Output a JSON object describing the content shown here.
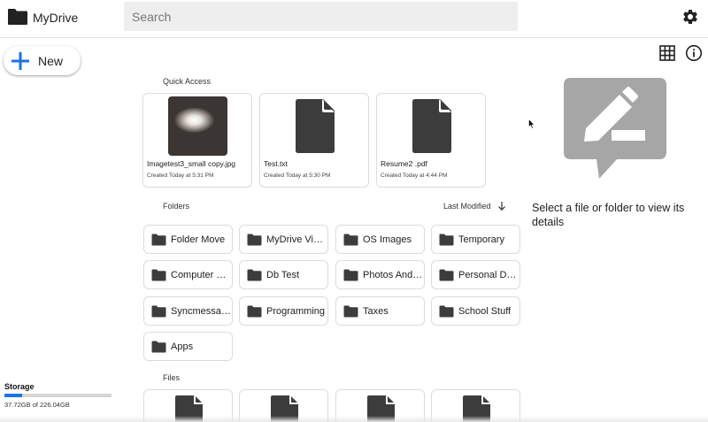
{
  "header": {
    "app_title": "MyDrive",
    "search_placeholder": "Search",
    "settings_icon": "gear-icon"
  },
  "toolbar": {
    "new_label": "New",
    "view_toggle_icon": "grid-icon",
    "info_icon": "info-icon"
  },
  "quick_access": {
    "title": "Quick Access",
    "items": [
      {
        "name": "Imagetest3_small copy.jpg",
        "created": "Created Today at 5:31 PM",
        "thumb": "photo"
      },
      {
        "name": "Test.txt",
        "created": "Created Today at 5:30 PM",
        "thumb": "file-icon"
      },
      {
        "name": "Resume2 .pdf",
        "created": "Created Today at 4:44 PM",
        "thumb": "file-icon"
      }
    ]
  },
  "folders": {
    "title": "Folders",
    "sort_label": "Last Modified",
    "sort_icon": "arrow-down-icon",
    "items": [
      {
        "name": "Folder Move"
      },
      {
        "name": "MyDrive Videos"
      },
      {
        "name": "OS Images"
      },
      {
        "name": "Temporary"
      },
      {
        "name": "Computer Recovery"
      },
      {
        "name": "Db Test"
      },
      {
        "name": "Photos And Videos"
      },
      {
        "name": "Personal Drive"
      },
      {
        "name": "Syncmessage"
      },
      {
        "name": "Programming"
      },
      {
        "name": "Taxes"
      },
      {
        "name": "School Stuff"
      },
      {
        "name": "Apps"
      }
    ]
  },
  "files": {
    "title": "Files",
    "count_visible": 4
  },
  "storage": {
    "label": "Storage",
    "usage_text": "37.72GB of 226.04GB",
    "used_fraction": 0.167
  },
  "details": {
    "empty_message": "Select a file or folder to view its details",
    "icon": "edit-comment-icon"
  },
  "colors": {
    "accent": "#1a73e8",
    "icon_dark": "#3c3c3c",
    "placeholder_icon": "#a6a6a6",
    "search_bg": "#eeeeee"
  }
}
